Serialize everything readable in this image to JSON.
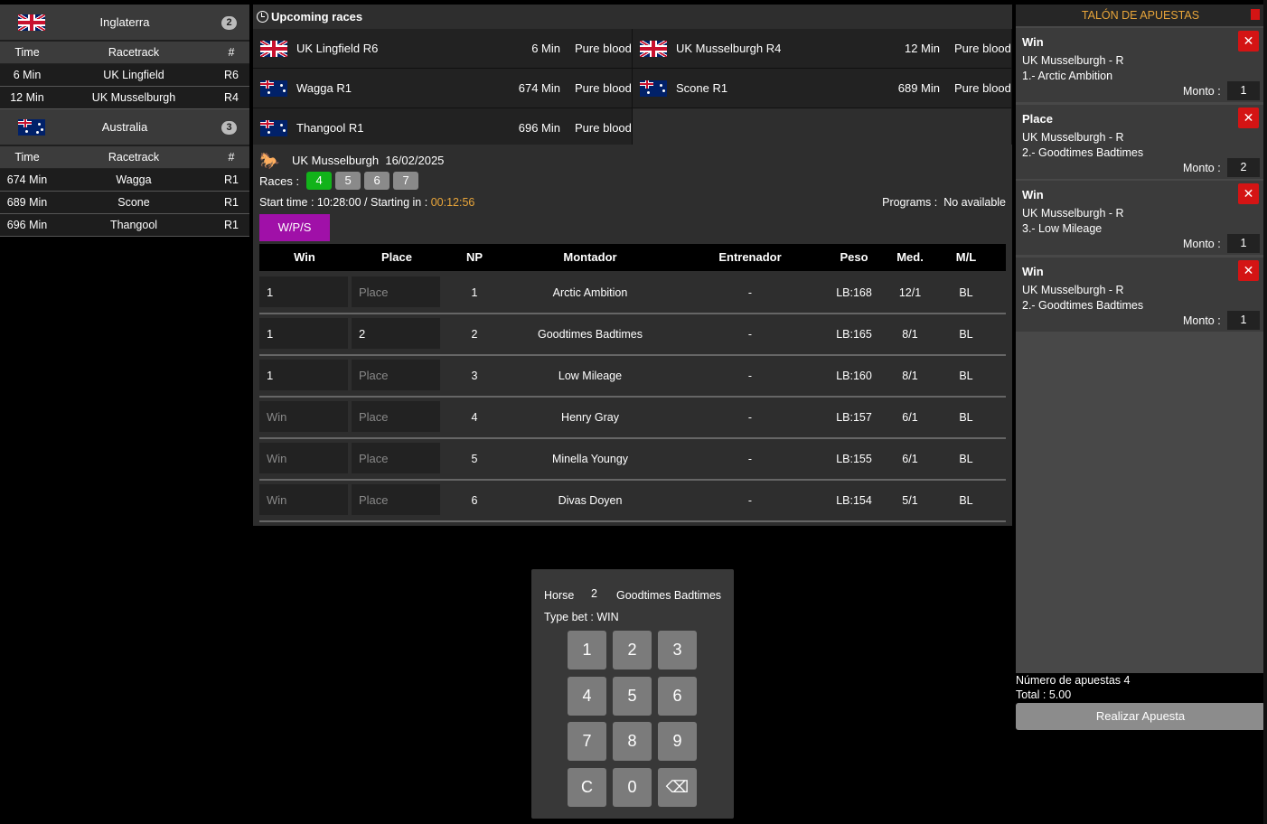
{
  "left_panel": {
    "groups": [
      {
        "country": "Inglaterra",
        "flag": "uk-flag",
        "count": "2",
        "headers": [
          "Time",
          "Racetrack",
          "#"
        ],
        "rows": [
          {
            "time": "6 Min",
            "track": "UK Lingfield",
            "race": "R6"
          },
          {
            "time": "12 Min",
            "track": "UK Musselburgh",
            "race": "R4"
          }
        ]
      },
      {
        "country": "Australia",
        "flag": "australia-flag",
        "count": "3",
        "headers": [
          "Time",
          "Racetrack",
          "#"
        ],
        "rows": [
          {
            "time": "674 Min",
            "track": "Wagga",
            "race": "R1"
          },
          {
            "time": "689 Min",
            "track": "Scone",
            "race": "R1"
          },
          {
            "time": "696 Min",
            "track": "Thangool",
            "race": "R1"
          }
        ]
      }
    ]
  },
  "upcoming": {
    "title": "Upcoming races",
    "races": [
      {
        "flag": "uk",
        "name": "UK Lingfield R6",
        "minutes": "6 Min",
        "type": "Pure blood"
      },
      {
        "flag": "uk",
        "name": "UK Musselburgh R4",
        "minutes": "12 Min",
        "type": "Pure blood"
      },
      {
        "flag": "au",
        "name": "Wagga R1",
        "minutes": "674 Min",
        "type": "Pure blood"
      },
      {
        "flag": "au",
        "name": "Scone R1",
        "minutes": "689 Min",
        "type": "Pure blood"
      },
      {
        "flag": "au",
        "name": "Thangool R1",
        "minutes": "696 Min",
        "type": "Pure blood"
      }
    ]
  },
  "race": {
    "track": "UK Musselburgh",
    "date": "16/02/2025",
    "races_label": "Races :",
    "race_numbers": [
      "4",
      "5",
      "6",
      "7"
    ],
    "active_race": "4",
    "start_label": "Start time : 10:28:00 / Starting in :",
    "countdown": "00:12:56",
    "programs_label": "Programs :",
    "programs_value": "No available",
    "bet_tab": "W/P/S",
    "columns": [
      "Win",
      "Place",
      "NP",
      "Montador",
      "Entrenador",
      "Peso",
      "Med.",
      "M/L"
    ],
    "runners": [
      {
        "win": "1",
        "place": "",
        "np": "1",
        "jockey": "Arctic Ambition",
        "trainer": "-",
        "weight": "LB:168",
        "odds": "12/1",
        "ml": "BL"
      },
      {
        "win": "1",
        "place": "2",
        "np": "2",
        "jockey": "Goodtimes Badtimes",
        "trainer": "-",
        "weight": "LB:165",
        "odds": "8/1",
        "ml": "BL"
      },
      {
        "win": "1",
        "place": "",
        "np": "3",
        "jockey": "Low Mileage",
        "trainer": "-",
        "weight": "LB:160",
        "odds": "8/1",
        "ml": "BL"
      },
      {
        "win": "",
        "place": "",
        "np": "4",
        "jockey": "Henry Gray",
        "trainer": "-",
        "weight": "LB:157",
        "odds": "6/1",
        "ml": "BL"
      },
      {
        "win": "",
        "place": "",
        "np": "5",
        "jockey": "Minella Youngy",
        "trainer": "-",
        "weight": "LB:155",
        "odds": "6/1",
        "ml": "BL"
      },
      {
        "win": "",
        "place": "",
        "np": "6",
        "jockey": "Divas Doyen",
        "trainer": "-",
        "weight": "LB:154",
        "odds": "5/1",
        "ml": "BL"
      }
    ],
    "win_placeholder": "Win",
    "place_placeholder": "Place"
  },
  "keypad": {
    "horse_label": "Horse",
    "horse_number": "2",
    "horse_name": "Goodtimes Badtimes",
    "type_bet": "Type bet : WIN",
    "keys": [
      "1",
      "2",
      "3",
      "4",
      "5",
      "6",
      "7",
      "8",
      "9",
      "C",
      "0",
      "⌫"
    ]
  },
  "ticket": {
    "title": "TALÓN DE APUESTAS",
    "bets": [
      {
        "type": "Win",
        "race": "UK Musselburgh - R",
        "horse": "1.- Arctic Ambition",
        "amount_label": "Monto :",
        "amount": "1"
      },
      {
        "type": "Place",
        "race": "UK Musselburgh - R",
        "horse": "2.- Goodtimes Badtimes",
        "amount_label": "Monto :",
        "amount": "2"
      },
      {
        "type": "Win",
        "race": "UK Musselburgh - R",
        "horse": "3.- Low Mileage",
        "amount_label": "Monto :",
        "amount": "1"
      },
      {
        "type": "Win",
        "race": "UK Musselburgh - R",
        "horse": "2.- Goodtimes Badtimes",
        "amount_label": "Monto :",
        "amount": "1"
      }
    ],
    "count_text": "Número de apuestas 4",
    "total_text": "Total : 5.00",
    "submit_label": "Realizar Apuesta"
  },
  "colors": {
    "active_race": "#12b31a",
    "tab": "#a010a8",
    "countdown": "#e8a53a",
    "delete": "#d41414"
  }
}
